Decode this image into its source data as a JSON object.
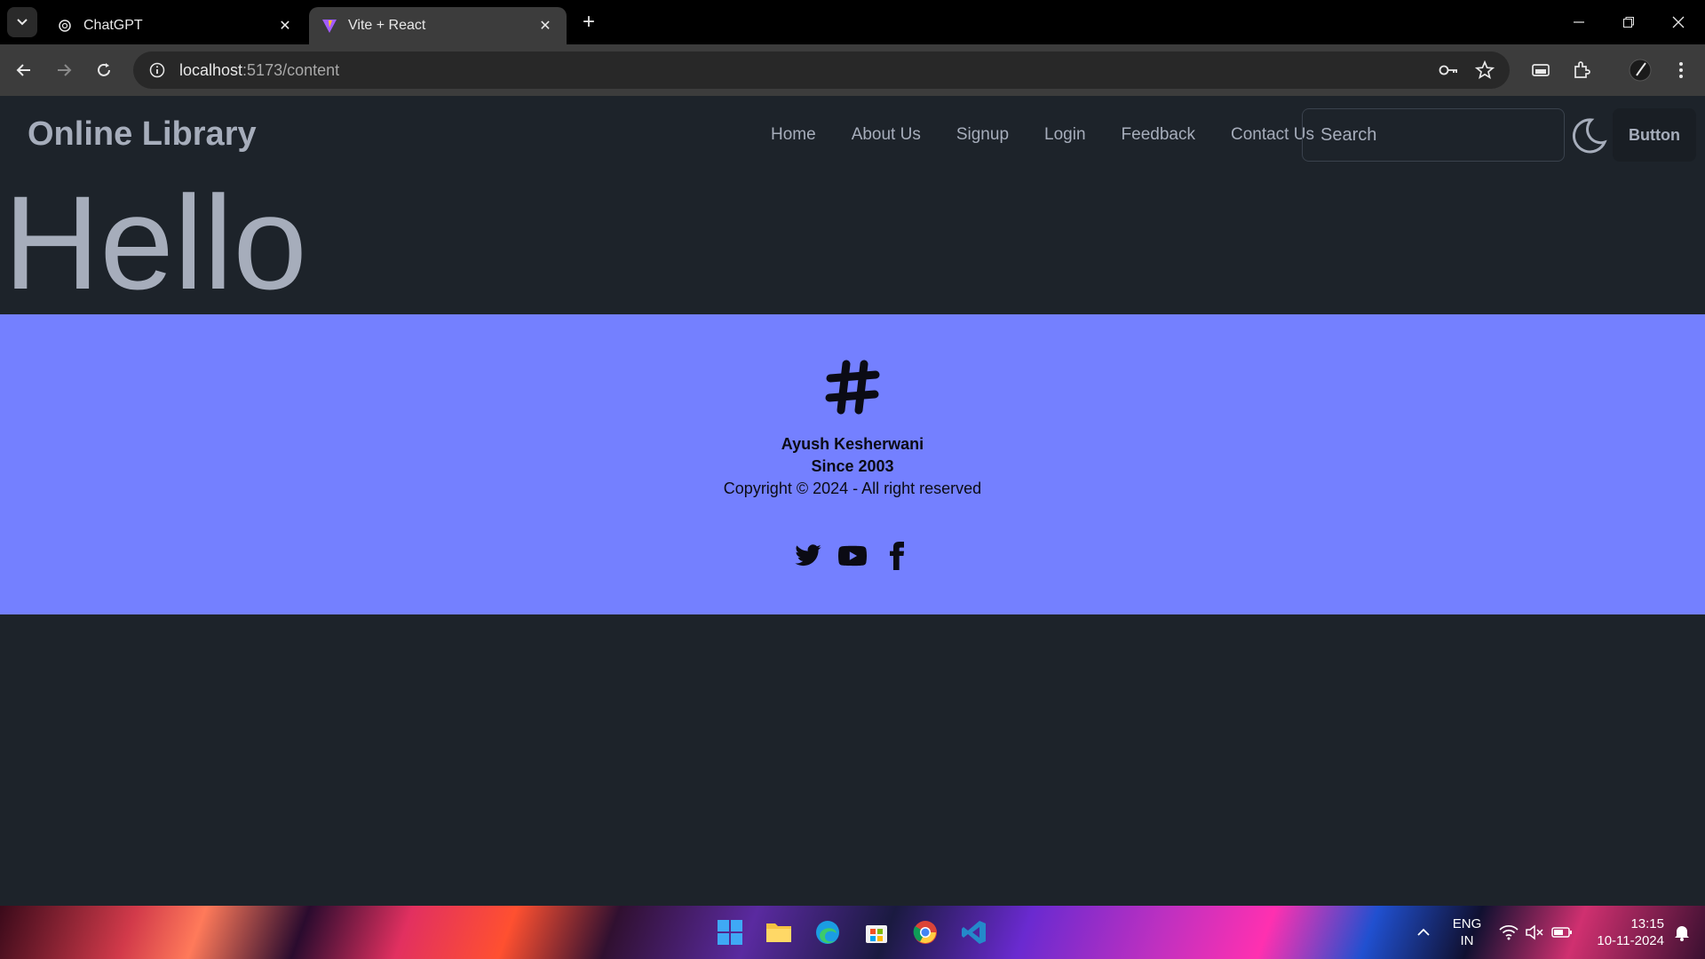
{
  "browser": {
    "tabs": [
      {
        "title": "ChatGPT",
        "favicon": "chatgpt-icon",
        "active": false
      },
      {
        "title": "Vite + React",
        "favicon": "vite-icon",
        "active": true
      }
    ],
    "url_host": "localhost",
    "url_path": ":5173/content"
  },
  "site": {
    "brand": "Online Library",
    "nav_links": [
      "Home",
      "About Us",
      "Signup",
      "Login",
      "Feedback",
      "Contact Us"
    ],
    "search_placeholder": "Search",
    "button_label": "Button"
  },
  "main": {
    "heading": "Hello"
  },
  "footer": {
    "name": "Ayush Kesherwani",
    "since": "Since 2003",
    "copyright": "Copyright © 2024 - All right reserved",
    "social": [
      "twitter-icon",
      "youtube-icon",
      "facebook-icon"
    ],
    "background": "#7480ff"
  },
  "taskbar": {
    "lang_top": "ENG",
    "lang_bottom": "IN",
    "time": "13:15",
    "date": "10-11-2024"
  }
}
